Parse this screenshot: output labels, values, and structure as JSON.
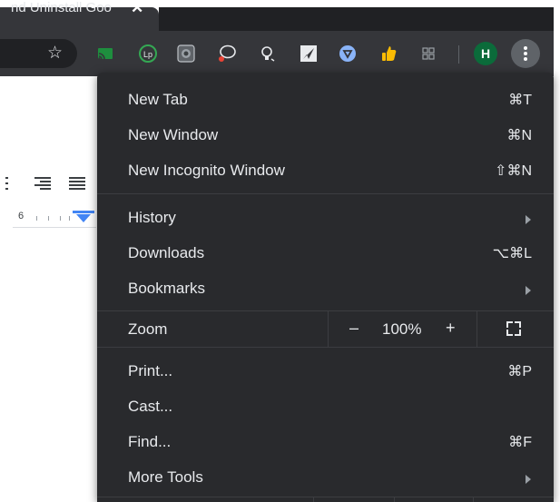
{
  "browser": {
    "tab": {
      "title": "nd Uninstall Goo",
      "close_glyph": "✕"
    },
    "new_tab_glyph": "+",
    "bookmark_glyph": "☆",
    "profile_initial": "H",
    "extensions": [
      {
        "icon": "cast-icon",
        "color": "#1e8e3e"
      },
      {
        "icon": "lastpass-icon",
        "color": "#f1f3f4"
      },
      {
        "icon": "screenshot-icon",
        "color": "#9aa0a6"
      },
      {
        "icon": "speech-bubble-icon",
        "color": "#e8eaed"
      },
      {
        "icon": "lightbulb-icon",
        "color": "#e8eaed"
      },
      {
        "icon": "paper-plane-icon",
        "color": "#e8eaed"
      },
      {
        "icon": "shield-icon",
        "color": "#8ab4f8"
      },
      {
        "icon": "thumbs-up-icon",
        "color": "#fbbc04"
      },
      {
        "icon": "grid-icon",
        "color": "#5f6368"
      }
    ]
  },
  "document": {
    "ruler_number": "6",
    "accent_color": "#4285f4"
  },
  "menu": {
    "items": [
      {
        "label": "New Tab",
        "shortcut": "⌘T"
      },
      {
        "label": "New Window",
        "shortcut": "⌘N"
      },
      {
        "label": "New Incognito Window",
        "shortcut": "⇧⌘N"
      },
      {
        "label": "History",
        "shortcut": ""
      },
      {
        "label": "Downloads",
        "shortcut": "⌥⌘L"
      },
      {
        "label": "Bookmarks",
        "shortcut": ""
      },
      {
        "label": "Print...",
        "shortcut": "⌘P"
      },
      {
        "label": "Cast...",
        "shortcut": ""
      },
      {
        "label": "Find...",
        "shortcut": "⌘F"
      },
      {
        "label": "More Tools",
        "shortcut": ""
      }
    ],
    "zoom": {
      "label": "Zoom",
      "minus": "–",
      "value": "100%",
      "plus": "+"
    }
  }
}
